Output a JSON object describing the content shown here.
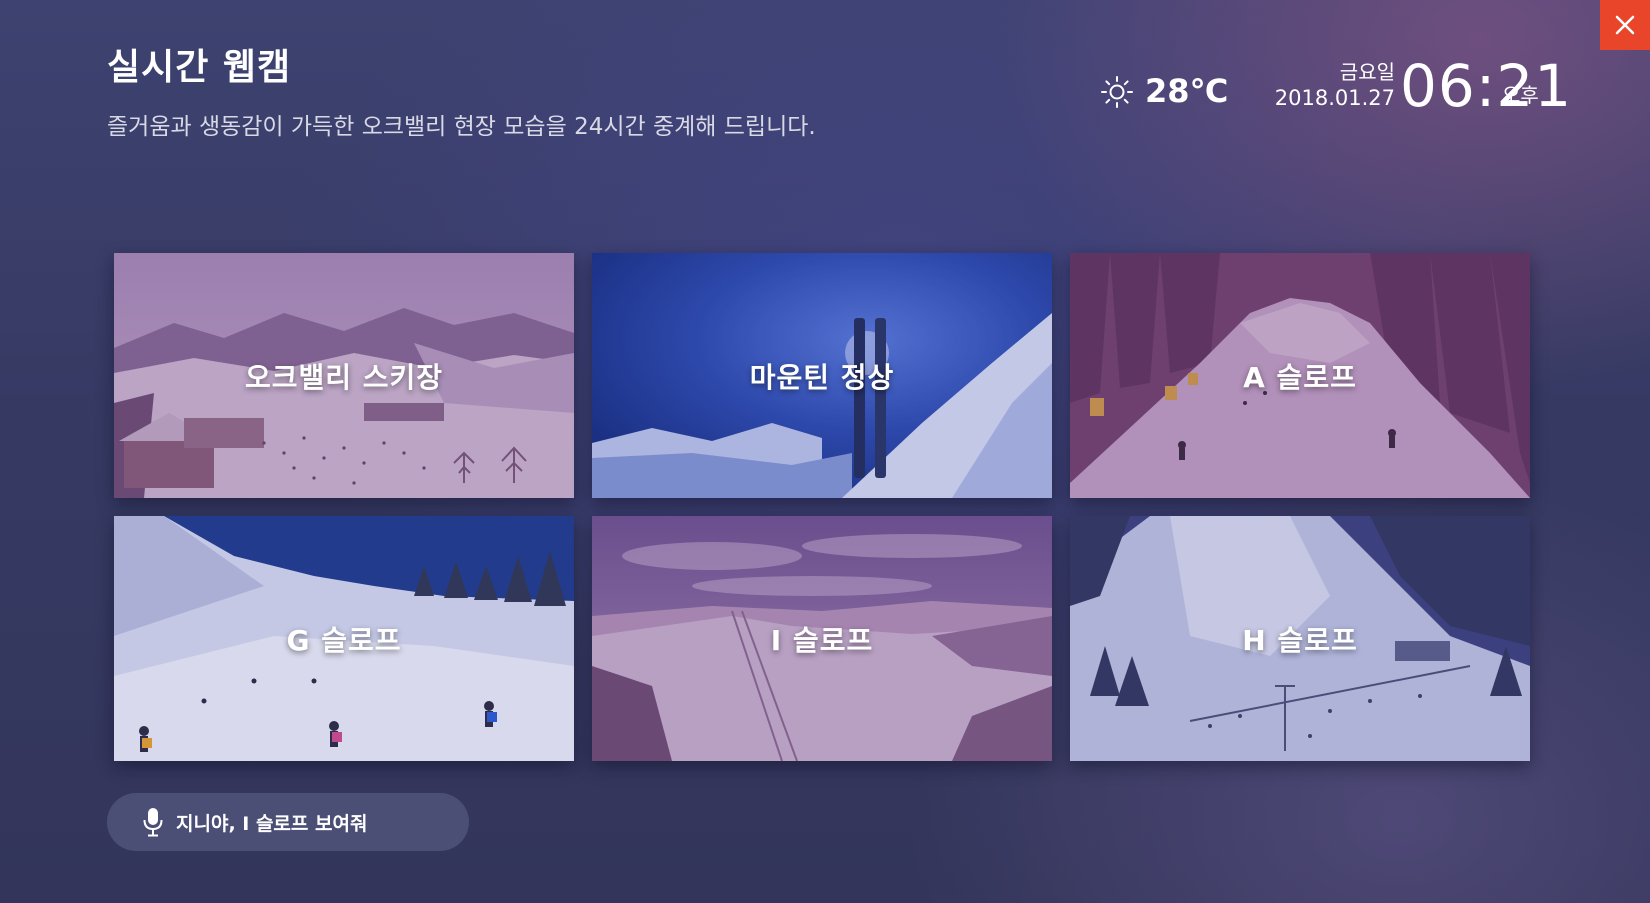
{
  "header": {
    "title": "실시간 웹캠",
    "subtitle": "즐거움과 생동감이 가득한 오크밸리 현장 모습을 24시간 중계해 드립니다."
  },
  "status": {
    "weather_icon": "sun-icon",
    "temperature": "28℃",
    "weekday": "금요일",
    "date": "2018.01.27",
    "time": "06:21",
    "ampm": "오후"
  },
  "close": {
    "icon": "close-icon",
    "color": "#e8452b"
  },
  "webcams": [
    {
      "label": "오크밸리 스키장"
    },
    {
      "label": "마운틴 정상"
    },
    {
      "label": "A 슬로프"
    },
    {
      "label": "G 슬로프"
    },
    {
      "label": "I 슬로프"
    },
    {
      "label": "H 슬로프"
    }
  ],
  "voice_hint": {
    "icon": "mic-icon",
    "text": "지니야, I 슬로프 보여줘"
  },
  "colors": {
    "accent": "#e8452b",
    "background": "#363a63",
    "tile_overlay": "#6a4a8a"
  }
}
